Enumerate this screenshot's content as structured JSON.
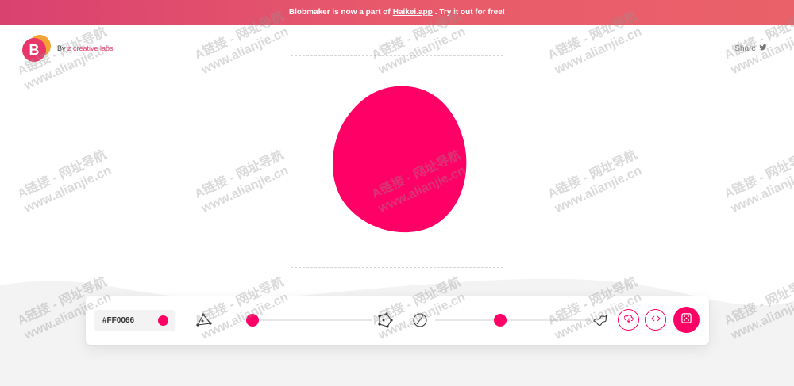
{
  "banner": {
    "prefix": "Blobmaker is now a part of",
    "link": "Haikei.app",
    "suffix": ". Try it out for free!"
  },
  "brand": {
    "logo_letter": "B",
    "by_prefix": "By",
    "by_link": "z creative labs"
  },
  "share": {
    "label": "Share"
  },
  "blob": {
    "fill": "#FF0066"
  },
  "toolbar": {
    "color_hex": "#FF0066",
    "complexity_value": 0.08,
    "contrast_value": 0.6
  },
  "colors": {
    "accent": "#FF0066",
    "banner_start": "#D9416F",
    "banner_end": "#EA6169"
  },
  "icons": [
    "triangle-nodes-icon",
    "polygon-nodes-icon",
    "circle-icon",
    "wobbly-shape-icon",
    "download-icon",
    "code-icon",
    "dice-icon",
    "twitter-icon"
  ],
  "watermark": {
    "line1": "A链接 - 网址导航",
    "line2": "www.alianjie.cn"
  }
}
